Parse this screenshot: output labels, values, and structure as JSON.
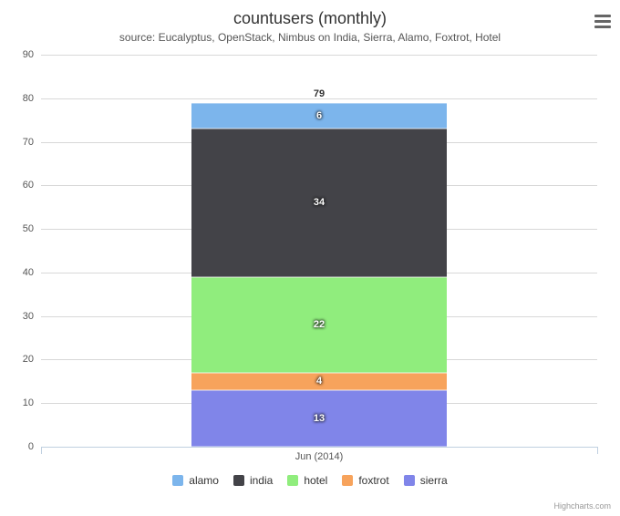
{
  "chart_data": {
    "type": "bar",
    "stacked": true,
    "title": "countusers (monthly)",
    "subtitle": "source: Eucalyptus, OpenStack, Nimbus on India, Sierra, Alamo, Foxtrot, Hotel",
    "categories": [
      "Jun (2014)"
    ],
    "series": [
      {
        "name": "sierra",
        "values": [
          13
        ],
        "color": "#8085e9"
      },
      {
        "name": "foxtrot",
        "values": [
          4
        ],
        "color": "#f7a35c"
      },
      {
        "name": "hotel",
        "values": [
          22
        ],
        "color": "#90ed7d"
      },
      {
        "name": "india",
        "values": [
          34
        ],
        "color": "#434348"
      },
      {
        "name": "alamo",
        "values": [
          6
        ],
        "color": "#7cb5ec"
      }
    ],
    "stack_totals": [
      79
    ],
    "xlabel": "",
    "ylabel": "",
    "ylim": [
      0,
      90
    ],
    "ytick_interval": 10,
    "legend_position": "bottom",
    "legend_order": [
      "alamo",
      "india",
      "hotel",
      "foxtrot",
      "sierra"
    ]
  },
  "credit": "Highcharts.com",
  "menu_button": "Chart context menu"
}
